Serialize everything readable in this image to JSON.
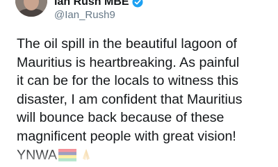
{
  "author": {
    "display_name": "Ian Rush MBE",
    "handle": "@Ian_Rush9",
    "verified": true
  },
  "tweet": {
    "lines": [
      "The oil spill in the beautiful lagoon of",
      "Mauritius is heartbreaking. As painful",
      "it can be for the locals to witness this",
      "disaster, I am confident that Mauritius",
      "will bounce back because of these",
      "magnificent people with great vision!",
      "YNWA"
    ],
    "emoji": [
      "mauritius-flag-emoji",
      "folded-hands-emoji"
    ]
  },
  "colors": {
    "text": "#14171a",
    "handle": "#657786",
    "verified": "#1da1f2",
    "flag": [
      "#ea2839",
      "#1a206d",
      "#ffd500",
      "#00a551"
    ]
  }
}
